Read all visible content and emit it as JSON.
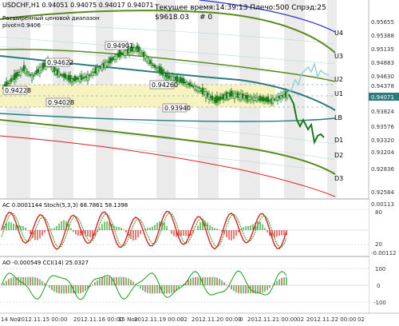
{
  "main": {
    "symbol_line": "USDCHF,H1  0.94051 0.94075 0.94017 0.94071",
    "sub1": "Расширенный ценовой диапазон",
    "sub2": "pivot=0.9406",
    "info_line1": "Текущее время:14:39:13 Плечо:500 Спрэд:25",
    "info_line2": "$9618.03",
    "info_hash": "# 0",
    "price_labels": [
      "0.94901",
      "0.94622",
      "0.94228",
      "0.94260",
      "0.94028",
      "0.93940"
    ],
    "levels": {
      "u4": "U4",
      "u3": "U3",
      "u2": "U2",
      "u1": "U1",
      "lb": "LB",
      "d1": "D1",
      "d2": "D2",
      "d3": "D3"
    },
    "right_ticks": [
      "0.95655",
      "0.95388",
      "0.95135",
      "0.94883",
      "0.94630",
      "0.94378",
      "0.94071",
      "0.93824",
      "0.93576",
      "0.93320",
      "0.93204",
      "0.92836",
      "0.92584"
    ],
    "last_price": "0.94071"
  },
  "ac": {
    "label": "AC 0.0001144  Stoch(5,3,3) 68.7861 58.1398",
    "ticks": [
      "0.00113",
      "80",
      "20",
      "-0.00112"
    ]
  },
  "ao": {
    "label": "AO -0.000549  CCI(14) 25.0327",
    "ticks": [
      "100",
      "0",
      "-100"
    ]
  },
  "timeaxis": {
    "labels": [
      "14 Nov",
      "2012.11.15 00:00",
      "2012.11.16 00:00",
      "15 Nov",
      "2012.11.19 00:00",
      "02",
      "2012.11.20 00:00",
      "0",
      "2012.11.21 00:00",
      "02",
      "2012.11.22 00:00",
      "02"
    ]
  },
  "colors": {
    "candle": "#1a7a1a",
    "olive": "#5c8a1a",
    "teal": "#2b7c7c",
    "blue": "#2b2bd6",
    "red": "#e02020",
    "band": "#f7f3c0"
  }
}
